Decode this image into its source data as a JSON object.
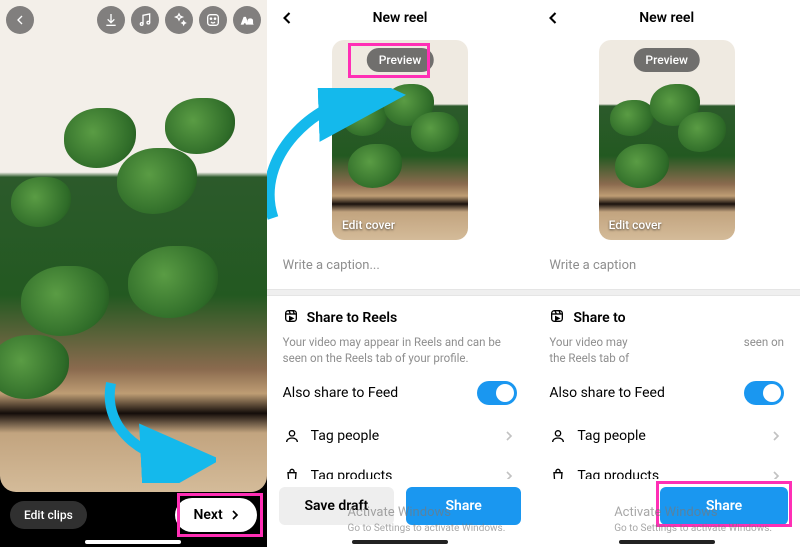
{
  "colors": {
    "accent": "#1a97f0",
    "highlight": "#ff2fb5"
  },
  "panel1": {
    "toolbar_icons": [
      "back-icon",
      "download-icon",
      "music-icon",
      "effects-icon",
      "sticker-icon",
      "text-icon"
    ],
    "edit_clips": "Edit clips",
    "next": "Next"
  },
  "panel2": {
    "title": "New reel",
    "preview": "Preview",
    "edit_cover": "Edit cover",
    "caption_placeholder": "Write a caption...",
    "share_heading": "Share to Reels",
    "share_desc": "Your video may appear in Reels and can be seen on the Reels tab of your profile.",
    "also_share": "Also share to Feed",
    "also_share_on": true,
    "tag_people": "Tag people",
    "tag_products": "Tag products",
    "save_draft": "Save draft",
    "share": "Share"
  },
  "panel3": {
    "title": "New reel",
    "preview": "Preview",
    "edit_cover": "Edit cover",
    "caption_placeholder": "Write a caption",
    "share_heading": "Share to",
    "share_desc_left": "Your video may\nthe Reels tab of",
    "share_desc_right": "seen on",
    "also_share": "Also share to Feed",
    "also_share_on": true,
    "tag_people": "Tag people",
    "tag_products": "Tag products",
    "share": "Share"
  },
  "watermark": {
    "line1": "Activate Windows",
    "line2": "Go to Settings to activate Windows."
  }
}
